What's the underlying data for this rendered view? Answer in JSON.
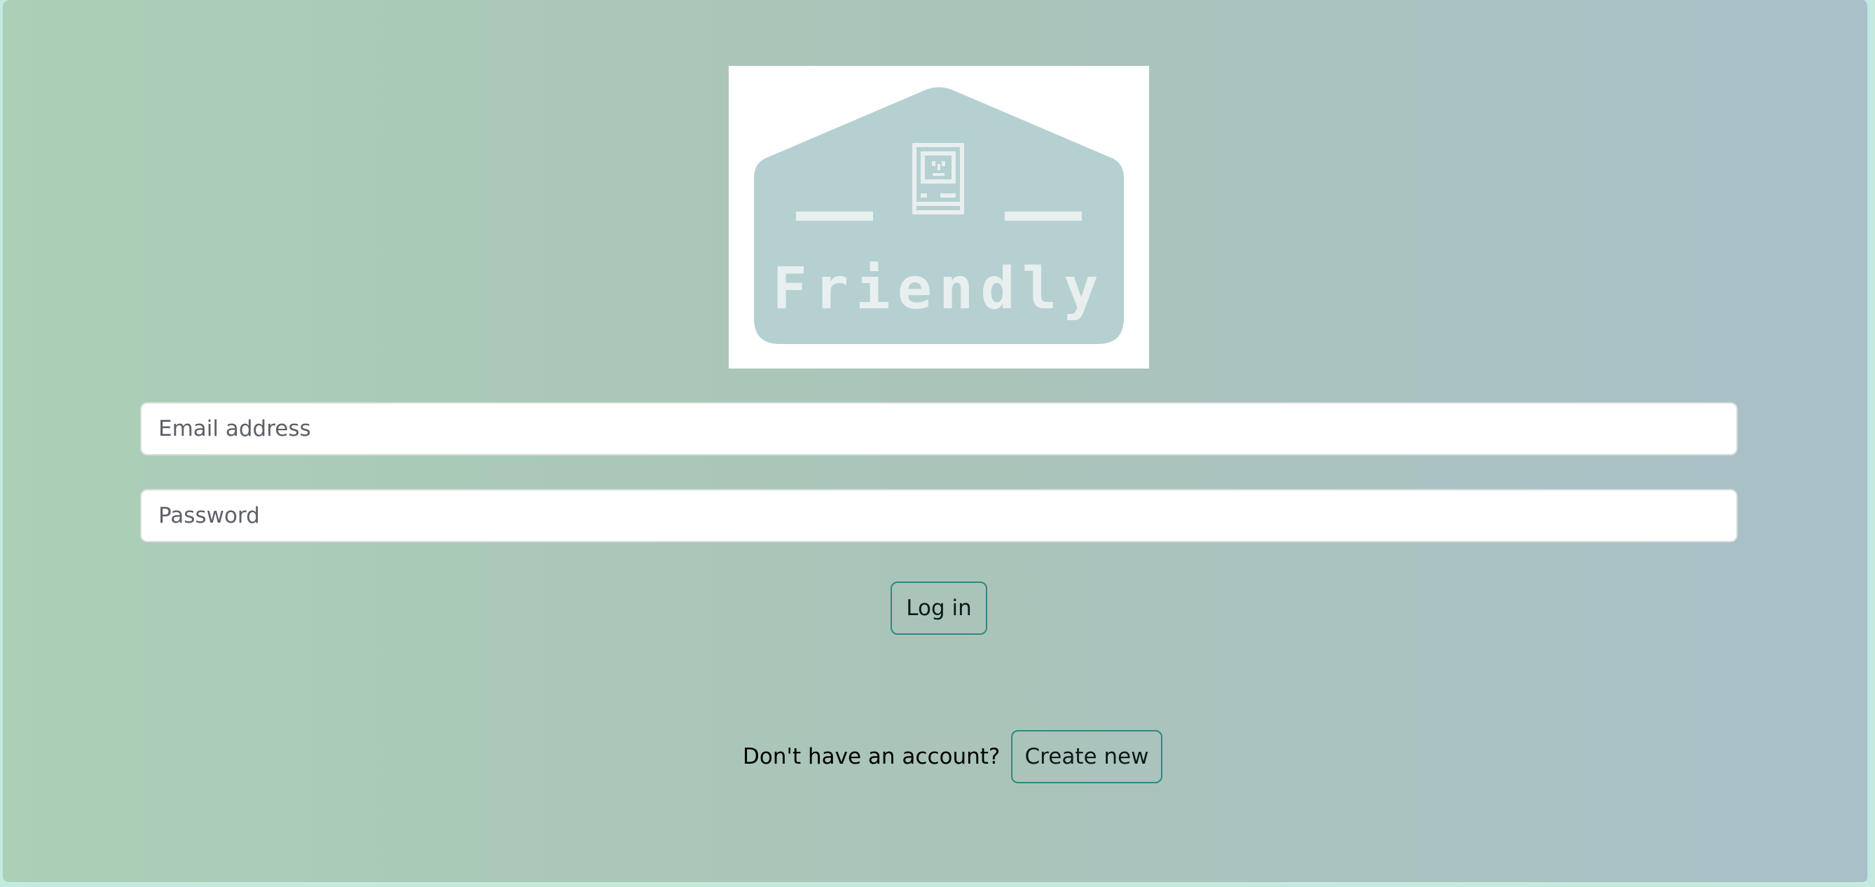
{
  "logo": {
    "text": "Friendly",
    "icon": "computer-face-icon",
    "badge_color": "#b5d0d1",
    "glyph_color": "#e8efee"
  },
  "login_form": {
    "email_placeholder": "Email address",
    "password_placeholder": "Password",
    "login_label": "Log in"
  },
  "signup": {
    "prompt": "Don't have an account?",
    "create_label": "Create new"
  },
  "colors": {
    "background_start": "#abcfb7",
    "background_end": "#a9c0c8",
    "button_border": "#2c8a83"
  }
}
